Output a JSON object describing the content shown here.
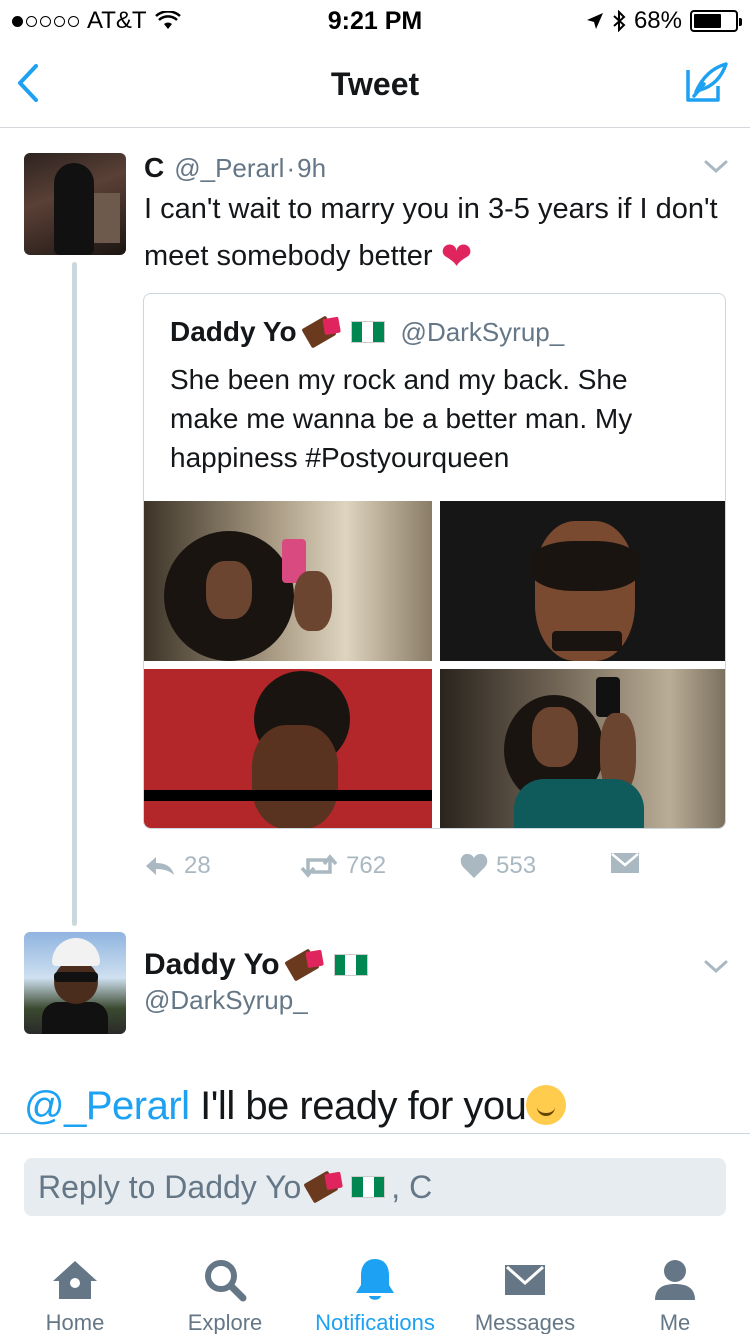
{
  "status_bar": {
    "carrier": "AT&T",
    "time": "9:21 PM",
    "battery": "68%",
    "battery_level": 0.68
  },
  "nav": {
    "title": "Tweet"
  },
  "main_tweet": {
    "name": "C",
    "handle": "@_Perarl",
    "separator": "·",
    "time": "9h",
    "text": "I can't wait to marry you in 3-5 years if I don't meet somebody better",
    "emoji": "heart"
  },
  "quoted_tweet": {
    "name": "Daddy Yo",
    "handle": "@DarkSyrup_",
    "text": "She been my rock and my back. She make me wanna be a better man. My happiness #Postyourqueen"
  },
  "actions": {
    "replies": "28",
    "retweets": "762",
    "likes": "553"
  },
  "reply_tweet": {
    "name": "Daddy Yo",
    "handle": "@DarkSyrup_",
    "mention": "@_Perarl",
    "text": " I'll be ready for you"
  },
  "composer": {
    "placeholder_prefix": "Reply to Daddy Yo",
    "placeholder_suffix": ", C"
  },
  "tabs": [
    {
      "label": "Home",
      "icon": "home-icon"
    },
    {
      "label": "Explore",
      "icon": "search-icon"
    },
    {
      "label": "Notifications",
      "icon": "bell-icon"
    },
    {
      "label": "Messages",
      "icon": "envelope-icon"
    },
    {
      "label": "Me",
      "icon": "person-icon"
    }
  ],
  "colors": {
    "accent": "#1da1f2",
    "muted": "#657786",
    "icon_gray": "#aab8c2"
  }
}
